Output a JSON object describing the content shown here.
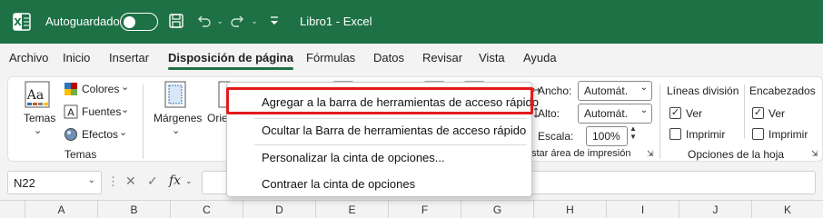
{
  "titlebar": {
    "autosave_label": "Autoguardado",
    "autosave_state": "off",
    "doc_title": "Libro1  -  Excel",
    "icons": [
      "excel-logo-icon",
      "save-icon",
      "undo-icon",
      "redo-icon",
      "customize-qat-icon"
    ]
  },
  "tabs": [
    {
      "label": "Archivo"
    },
    {
      "label": "Inicio"
    },
    {
      "label": "Insertar"
    },
    {
      "label": "Disposición de página",
      "active": true
    },
    {
      "label": "Fórmulas"
    },
    {
      "label": "Datos"
    },
    {
      "label": "Revisar"
    },
    {
      "label": "Vista"
    },
    {
      "label": "Ayuda"
    }
  ],
  "ribbon": {
    "temas": {
      "temas_label": "Temas",
      "colores_label": "Colores",
      "fuentes_label": "Fuentes",
      "efectos_label": "Efectos",
      "group_label": "Temas"
    },
    "configurar": {
      "margenes_label": "Márgenes",
      "orientacion_label": "Orie"
    },
    "ajustar": {
      "ancho_label": "Ancho:",
      "ancho_value": "Automát.",
      "alto_label": "Alto:",
      "alto_value": "Automát.",
      "escala_label": "Escala:",
      "escala_value": "100%",
      "group_label": "star área de impresión"
    },
    "opciones_hoja": {
      "lineas_label": "Líneas división",
      "encabezados_label": "Encabezados",
      "ver_label": "Ver",
      "imprimir_label": "Imprimir",
      "group_label": "Opciones de la hoja",
      "lineas_ver_checked": true,
      "lineas_imprimir_checked": false,
      "encabezados_ver_checked": true,
      "encabezados_imprimir_checked": false
    }
  },
  "formula_bar": {
    "name_box": "N22",
    "fx_label": "fx"
  },
  "columns": [
    "A",
    "B",
    "C",
    "D",
    "E",
    "F",
    "G",
    "H",
    "I",
    "J",
    "K"
  ],
  "context_menu": {
    "items": [
      {
        "label": "Agregar a la barra de herramientas de acceso rápido",
        "highlighted": true
      },
      {
        "label": "Ocultar la Barra de herramientas de acceso rápido"
      },
      {
        "label": "Personalizar la cinta de opciones..."
      },
      {
        "label": "Contraer la cinta de opciones"
      }
    ]
  },
  "colors": {
    "brand_green": "#1e7145",
    "highlight_red": "#e41b1b"
  }
}
